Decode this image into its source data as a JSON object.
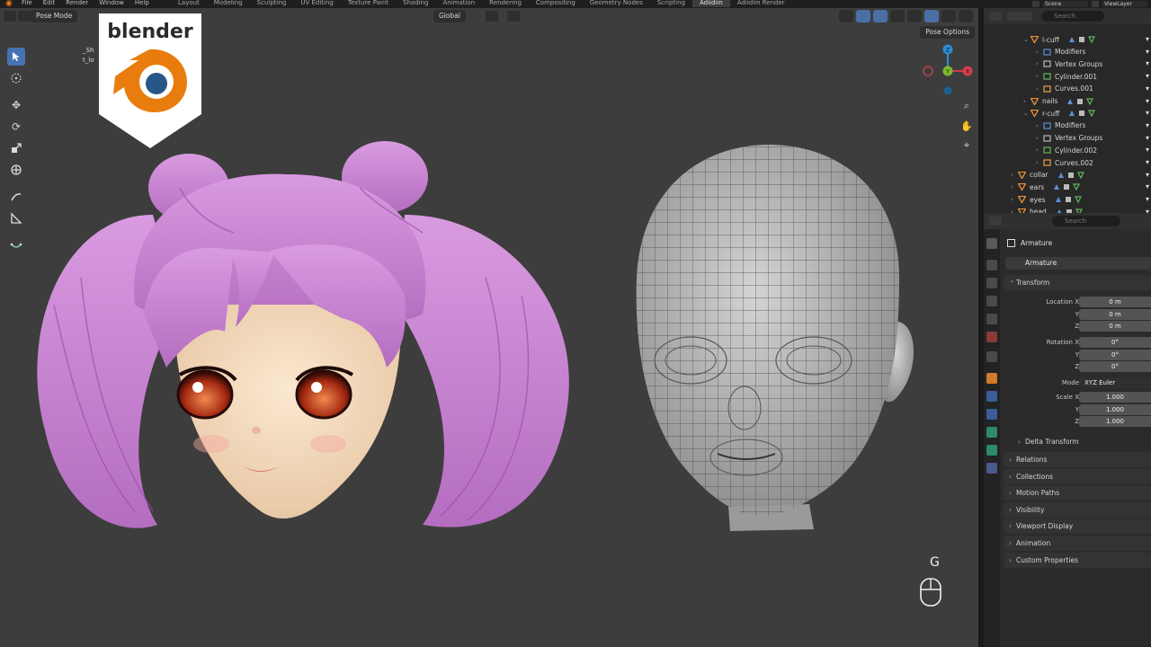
{
  "menu": [
    "File",
    "Edit",
    "Render",
    "Window",
    "Help"
  ],
  "workspaces": [
    {
      "label": "Layout",
      "active": false
    },
    {
      "label": "Modeling",
      "active": false
    },
    {
      "label": "Sculpting",
      "active": false
    },
    {
      "label": "UV Editing",
      "active": false
    },
    {
      "label": "Texture Paint",
      "active": false
    },
    {
      "label": "Shading",
      "active": false
    },
    {
      "label": "Animation",
      "active": false
    },
    {
      "label": "Rendering",
      "active": false
    },
    {
      "label": "Compositing",
      "active": false
    },
    {
      "label": "Geometry Nodes",
      "active": false
    },
    {
      "label": "Scripting",
      "active": false
    },
    {
      "label": "Adiidiin",
      "active": true
    },
    {
      "label": "Adiidiin Render",
      "active": false
    }
  ],
  "topright": {
    "scene": "Scene",
    "view_layer": "ViewLayer"
  },
  "viewport": {
    "mode": "Pose Mode",
    "orientation": "Global",
    "pose_options": "Pose Options",
    "overlay_text_lines": [
      "_Sh",
      "t_lo"
    ],
    "key_pressed": "G",
    "gizmo_labels": {
      "x": "X",
      "y": "Y",
      "z": "Z"
    }
  },
  "branding": {
    "logo_text": "blender",
    "accent": "#e87d0d",
    "blue": "#265787"
  },
  "outliner": {
    "search_placeholder": "Search",
    "rows": [
      {
        "label": "l-cuff",
        "depth": 0
      },
      {
        "label": "Modifiers",
        "depth": 1
      },
      {
        "label": "Vertex Groups",
        "depth": 1
      },
      {
        "label": "Cylinder.001",
        "depth": 1
      },
      {
        "label": "Curves.001",
        "depth": 1
      },
      {
        "label": "nails",
        "depth": 0
      },
      {
        "label": "r-cuff",
        "depth": 0
      },
      {
        "label": "Modifiers",
        "depth": 1
      },
      {
        "label": "Vertex Groups",
        "depth": 1
      },
      {
        "label": "Cylinder.002",
        "depth": 1
      },
      {
        "label": "Curves.002",
        "depth": 1
      },
      {
        "label": "collar",
        "depth": -1
      },
      {
        "label": "ears",
        "depth": -1
      },
      {
        "label": "eyes",
        "depth": -1
      },
      {
        "label": "head",
        "depth": -1
      }
    ]
  },
  "properties": {
    "search_placeholder": "Search",
    "object_name": "Armature",
    "data_name": "Armature",
    "transform_title": "Transform",
    "location": {
      "label": "Location X",
      "y_label": "Y",
      "z_label": "Z",
      "x": "0 m",
      "y": "0 m",
      "z": "0 m"
    },
    "rotation": {
      "label": "Rotation X",
      "y_label": "Y",
      "z_label": "Z",
      "x": "0°",
      "y": "0°",
      "z": "0°"
    },
    "mode": {
      "label": "Mode",
      "value": "XYZ Euler"
    },
    "scale": {
      "label": "Scale X",
      "y_label": "Y",
      "z_label": "Z",
      "x": "1.000",
      "y": "1.000",
      "z": "1.000"
    },
    "delta_transform": "Delta Transform",
    "panels": [
      "Relations",
      "Collections",
      "Motion Paths",
      "Visibility",
      "Viewport Display",
      "Animation",
      "Custom Properties"
    ]
  }
}
